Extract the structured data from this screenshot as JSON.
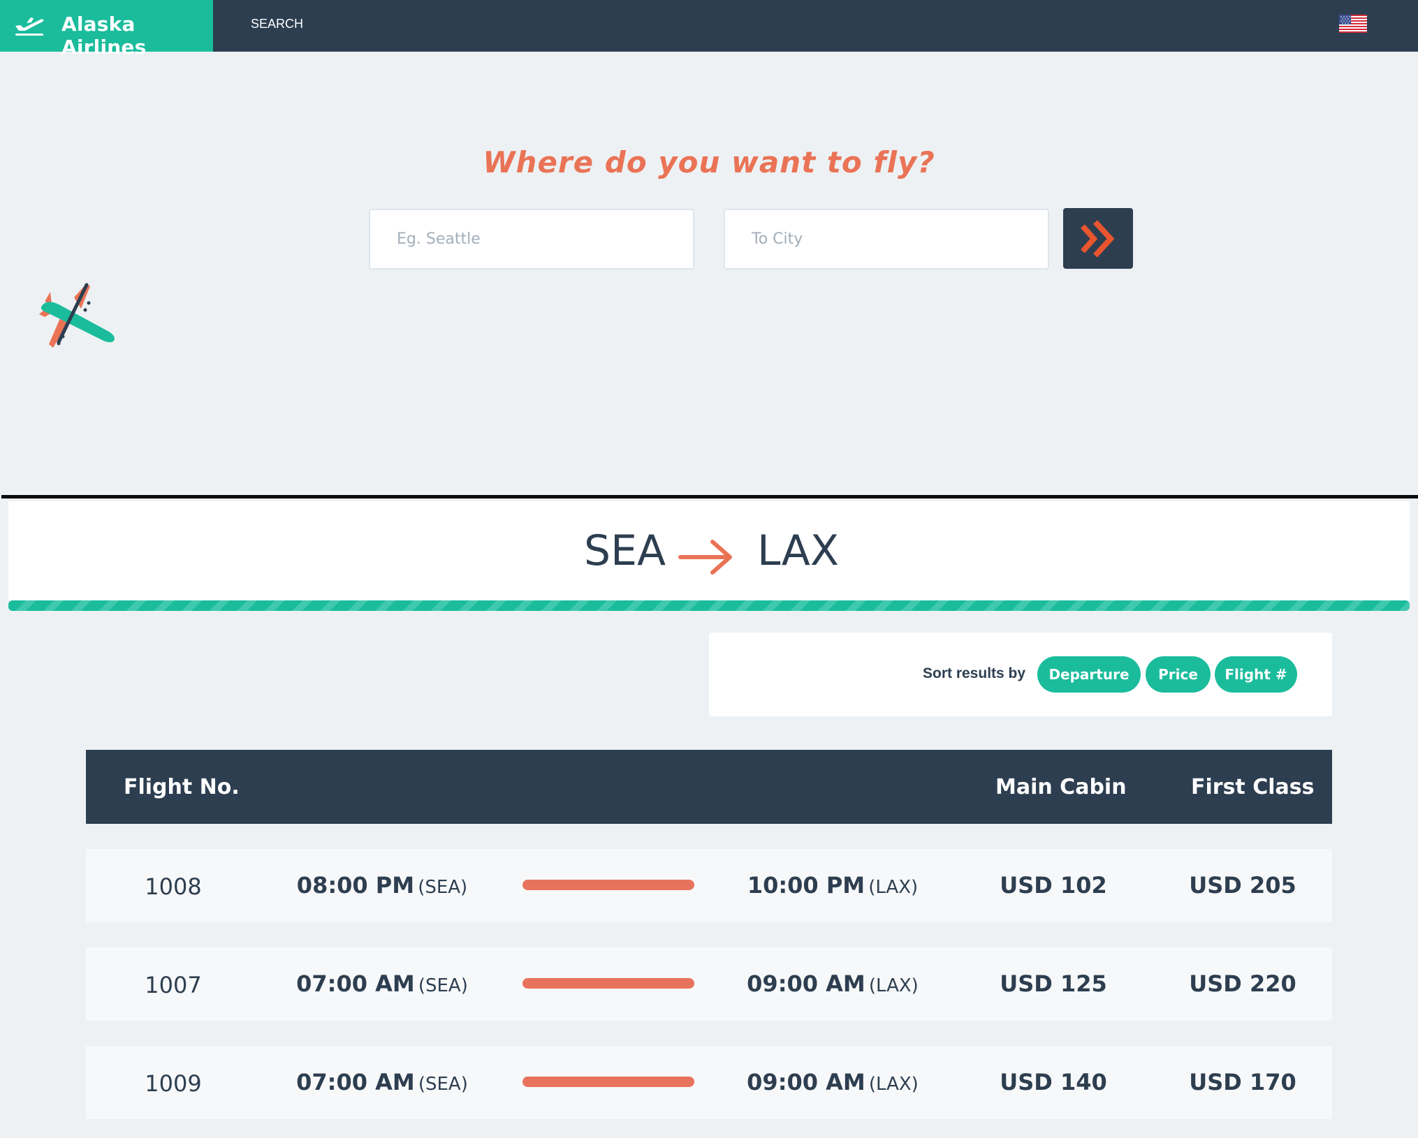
{
  "navbar": {
    "brand": "Alaska Airlines",
    "brand_icon": "plane-takeoff-icon",
    "search_link": "SEARCH",
    "flag_icon": "us-flag-icon"
  },
  "search": {
    "heading": "Where do you want to fly?",
    "from_placeholder": "Eg. Seattle",
    "to_placeholder": "To City",
    "submit_icon": "double-chevron-right-icon"
  },
  "route": {
    "origin": "SEA",
    "destination": "LAX",
    "arrow_icon": "arrow-right-icon"
  },
  "sort": {
    "label": "Sort results by",
    "options": [
      "Departure",
      "Price",
      "Flight #"
    ]
  },
  "table": {
    "headers": {
      "flight_no": "Flight No.",
      "main_cabin": "Main Cabin",
      "first_class": "First Class"
    },
    "rows": [
      {
        "flight": "1008",
        "depart_time": "08:00 PM",
        "depart_code": "(SEA)",
        "arrive_time": "10:00 PM",
        "arrive_code": "(LAX)",
        "main_cabin": "USD 102",
        "first_class": "USD 205"
      },
      {
        "flight": "1007",
        "depart_time": "07:00 AM",
        "depart_code": "(SEA)",
        "arrive_time": "09:00 AM",
        "arrive_code": "(LAX)",
        "main_cabin": "USD 125",
        "first_class": "USD 220"
      },
      {
        "flight": "1009",
        "depart_time": "07:00 AM",
        "depart_code": "(SEA)",
        "arrive_time": "09:00 AM",
        "arrive_code": "(LAX)",
        "main_cabin": "USD 140",
        "first_class": "USD 170"
      }
    ]
  },
  "colors": {
    "navy": "#2d3e50",
    "teal": "#1abc9c",
    "coral": "#ea7356",
    "background": "#edf1f3"
  }
}
